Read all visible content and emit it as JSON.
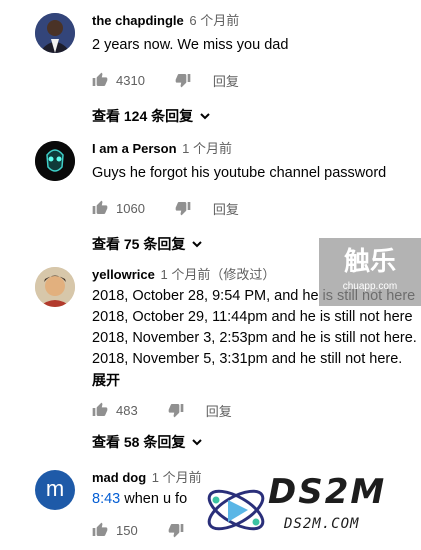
{
  "comments": [
    {
      "author": "the chapdingle",
      "time": "6 个月前",
      "lines": [
        "2 years now. We miss you dad"
      ],
      "likes": "4310",
      "reply_label": "回复",
      "replies_label": "查看 124 条回复"
    },
    {
      "author": "I am a Person",
      "time": "1 个月前",
      "lines": [
        "Guys he forgot his youtube channel password"
      ],
      "likes": "1060",
      "reply_label": "回复",
      "replies_label": "查看 75 条回复"
    },
    {
      "author": "yellowrice",
      "time": "1 个月前（修改过）",
      "lines": [
        "2018, October 28, 9:54 PM, and he is still not here",
        "2018, October 29, 11:44pm and he is still not here",
        "2018, November 3, 2:53pm and he is still not here.",
        "2018, November 5, 3:31pm and he still not here."
      ],
      "expand_label": "展开",
      "likes": "483",
      "reply_label": "回复",
      "replies_label": "查看 58 条回复"
    },
    {
      "author": "mad dog",
      "time": "1 个月前",
      "avatar_letter": "m",
      "timestamp_link": "8:43",
      "text_after_link": " when u fo",
      "likes": "150"
    }
  ],
  "watermarks": {
    "chuapp_main": "触乐",
    "chuapp_sub": "chuapp.com",
    "ds2m_main": "DS2M",
    "ds2m_sub": "DS2M.COM"
  },
  "colors": {
    "text": "#030303",
    "secondary": "#606060",
    "link": "#065fd4",
    "avatar_blue": "#1e5aa8"
  }
}
